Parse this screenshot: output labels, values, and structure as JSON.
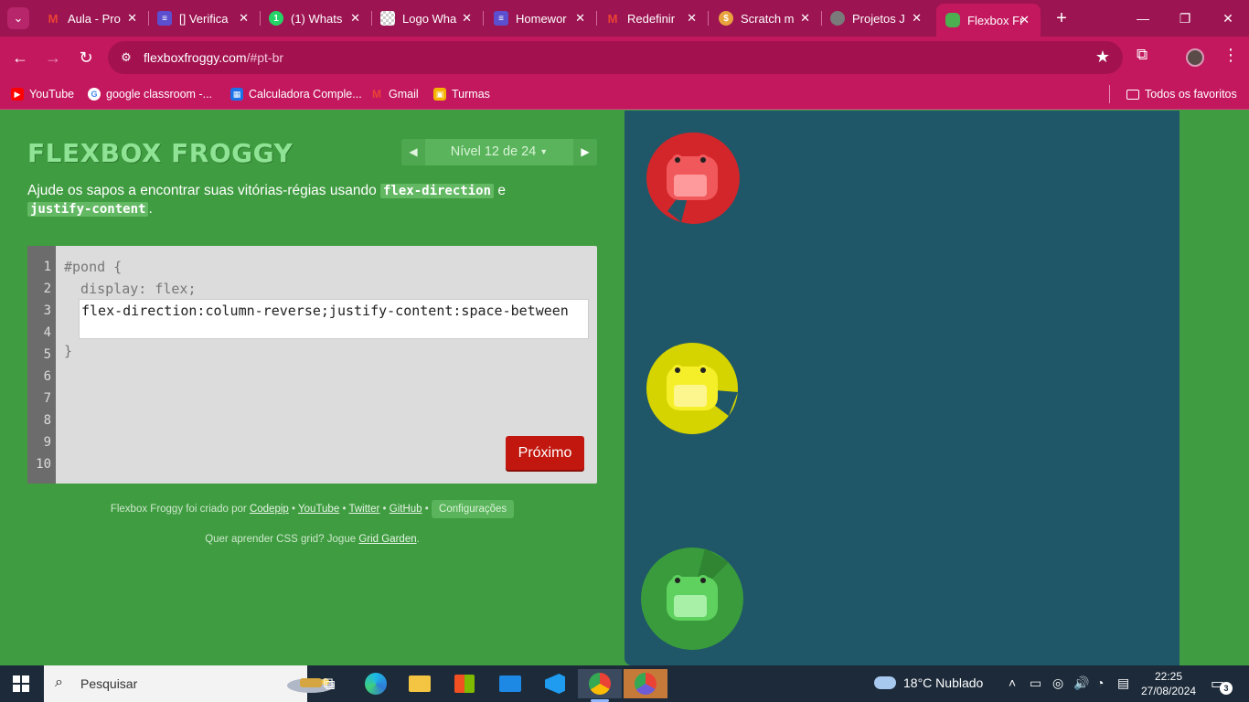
{
  "browser": {
    "tabs": [
      {
        "title": "Aula - Pro",
        "favicon_color": "#4285f4",
        "favicon_glyph": "M",
        "icon": "gmail-icon"
      },
      {
        "title": "[] Verifica",
        "favicon_color": "#5b4fcf",
        "favicon_glyph": "≡",
        "icon": "forms-icon"
      },
      {
        "title": "(1) Whats",
        "favicon_color": "#25d366",
        "favicon_glyph": "1",
        "icon": "whatsapp-icon"
      },
      {
        "title": "Logo Wha",
        "favicon_color": "#e0e0e0",
        "favicon_glyph": "",
        "icon": "checkerboard-icon"
      },
      {
        "title": "Homewor",
        "favicon_color": "#5b4fcf",
        "favicon_glyph": "≡",
        "icon": "forms-icon"
      },
      {
        "title": "Redefinir",
        "favicon_color": "#4285f4",
        "favicon_glyph": "M",
        "icon": "gmail-icon"
      },
      {
        "title": "Scratch m",
        "favicon_color": "#e8a33d",
        "favicon_glyph": "$",
        "icon": "scratch-icon"
      },
      {
        "title": "Projetos J",
        "favicon_color": "#7a7a7a",
        "favicon_glyph": "",
        "icon": "globe-icon"
      },
      {
        "title": "Flexbox Fr",
        "favicon_color": "#4caf50",
        "favicon_glyph": "",
        "icon": "frog-icon",
        "active": true
      }
    ],
    "url_host": "flexboxfroggy.com",
    "url_path": "/#pt-br",
    "bookmarks": [
      {
        "label": "YouTube",
        "color": "#ff0000",
        "glyph": "▶"
      },
      {
        "label": "google classroom -...",
        "color": "#ffffff",
        "glyph": "G"
      },
      {
        "label": "Calculadora Comple...",
        "color": "#1a73e8",
        "glyph": "▦"
      },
      {
        "label": "Gmail",
        "color": "#ea4335",
        "glyph": "M"
      },
      {
        "label": "Turmas",
        "color": "#f4b400",
        "glyph": "▣"
      }
    ],
    "all_bookmarks": "Todos os favoritos"
  },
  "game": {
    "logo": "FLEXBOX FROGGY",
    "level_label": "Nível 12 de 24",
    "instructions_before": "Ajude os sapos a encontrar suas vitórias-régias usando ",
    "kw1": "flex-direction",
    "instructions_mid": " e",
    "kw2": "justify-content",
    "instructions_after": ".",
    "line_numbers": [
      "1",
      "2",
      "3",
      "4",
      "5",
      "6",
      "7",
      "8",
      "9",
      "10"
    ],
    "code_line1": "#pond {",
    "code_line2": "  display: flex;",
    "code_input": "flex-direction:column-reverse;justify-content:space-between",
    "code_close": "}",
    "next_label": "Próximo",
    "credits_prefix": "Flexbox Froggy foi criado por ",
    "credit_codepip": "Codepip",
    "credit_youtube": "YouTube",
    "credit_twitter": "Twitter",
    "credit_github": "GitHub",
    "bullet": "•",
    "settings_label": "Configurações",
    "promo_prefix": "Quer aprender CSS grid? Jogue ",
    "promo_link": "Grid Garden",
    "promo_suffix": ".",
    "pond_color": "#1f5768",
    "lilies": [
      {
        "color": "red",
        "pad": "#d3262a",
        "frog": "#f0585c",
        "belly": "#ff9a9c"
      },
      {
        "color": "yellow",
        "pad": "#d6d400",
        "frog": "#f5ef2a",
        "belly": "#fdf58e"
      },
      {
        "color": "green",
        "pad": "#3a9b3c",
        "frog": "#5ed15f",
        "belly": "#a8f0a8"
      }
    ]
  },
  "taskbar": {
    "search_placeholder": "Pesquisar",
    "weather": "18°C  Nublado",
    "time": "22:25",
    "date": "27/08/2024",
    "notifications": "3",
    "apps": [
      "task-view-icon",
      "edge-icon",
      "file-explorer-icon",
      "store-icon",
      "mail-icon",
      "vscode-icon",
      "chrome-icon",
      "chrome-profile-icon"
    ]
  }
}
